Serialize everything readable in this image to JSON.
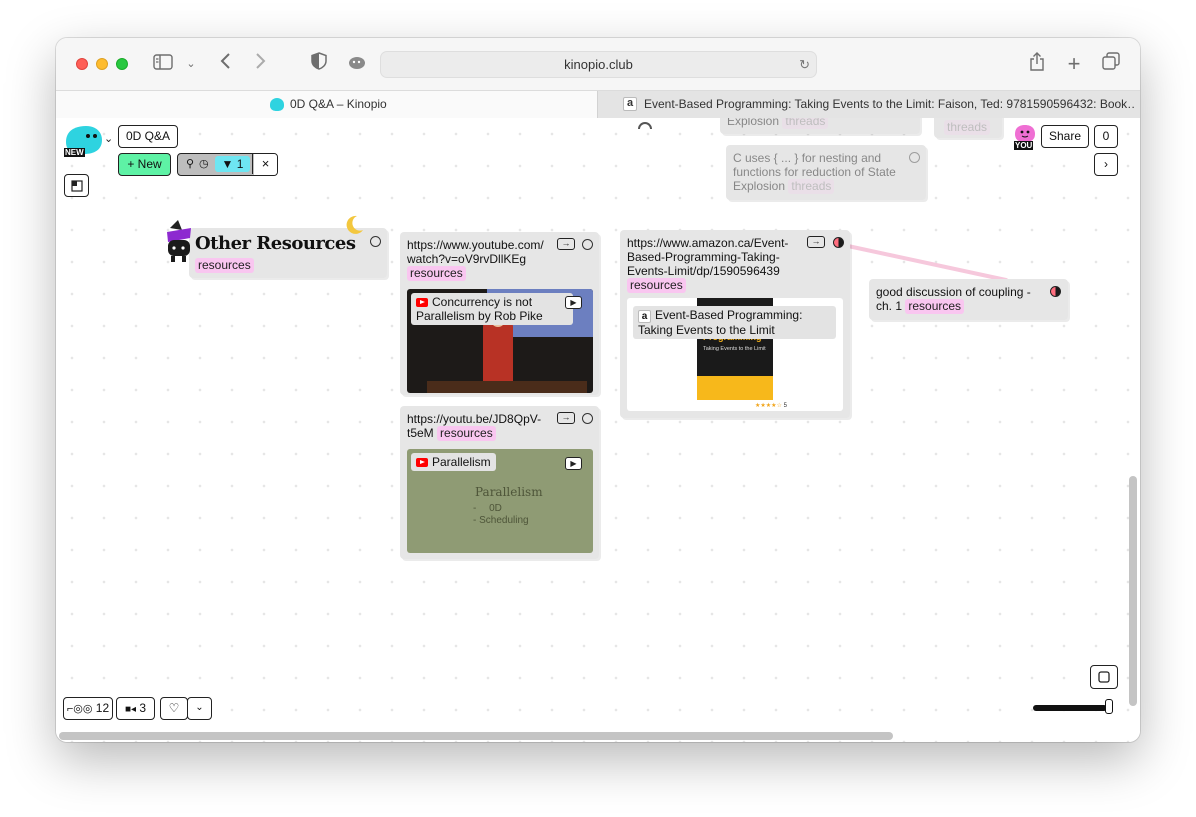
{
  "browser": {
    "url": "kinopio.club",
    "tabs": [
      {
        "title": "0D Q&A – Kinopio",
        "active": true
      },
      {
        "title": "Event-Based Programming: Taking Events to the Limit: Faison, Ted: 9781590596432: Book…",
        "active": false
      }
    ]
  },
  "header": {
    "new_badge": "NEW",
    "space_name": "0D Q&A",
    "new_button": "+ New",
    "filter_count": "1",
    "clear_icon": "×",
    "you_label": "YOU",
    "share_button": "Share",
    "notifications_count": "0"
  },
  "cards": {
    "faded_top": {
      "text": "Explosion",
      "tag": "threads"
    },
    "faded_threads": {
      "tag": "threads"
    },
    "c_uses": {
      "text": "C uses { ... } for nesting and functions for reduction of State Explosion",
      "tag": "threads"
    },
    "other_resources": {
      "title": "Other Resources",
      "tag": "resources"
    },
    "youtube1": {
      "url": "https://www.youtube.com/ watch?v=oV9rvDllKEg",
      "tag": "resources",
      "preview_title": "Concurrency is not Parallelism by Rob Pike"
    },
    "youtube2": {
      "url": "https://youtu.be/JD8QpV- t5eM",
      "tag": "resources",
      "preview_title": "Parallelism",
      "slide_title": "Parallelism",
      "slide_line1": "0D",
      "slide_line2": "Scheduling"
    },
    "amazon": {
      "url": "https://www.amazon.ca/Event-Based-Programming-Taking-Events-Limit/dp/1590596439",
      "tag": "resources",
      "preview_title": "Event-Based Programming: Taking Events to the Limit",
      "book_cover_text": "Programming",
      "book_subtitle": "Taking Events to the Limit",
      "rating_count": "5"
    },
    "coupling": {
      "text": "good discussion of coupling - ch. 1",
      "tag": "resources"
    }
  },
  "footer": {
    "readers_count": "12",
    "video_count": "3"
  },
  "colors": {
    "tag_pink": "#f9c6f0",
    "new_green": "#5ef2a5",
    "filter_cyan": "#6ee6f2",
    "card_bg": "#e6e6e6",
    "connection": "#f6c8dc"
  },
  "icons": [
    "sidebar-icon",
    "chevron-down-icon",
    "back-icon",
    "forward-icon",
    "shield-icon",
    "extension-icon",
    "reload-icon",
    "share-icon",
    "plus-icon",
    "tabs-icon",
    "amazon-icon",
    "kinopio-icon",
    "search-icon",
    "clock-icon",
    "filter-icon",
    "close-icon",
    "glasses-icon",
    "video-icon",
    "heart-icon",
    "minimap-icon",
    "select-box-icon",
    "moon-icon",
    "play-icon",
    "youtube-icon"
  ]
}
